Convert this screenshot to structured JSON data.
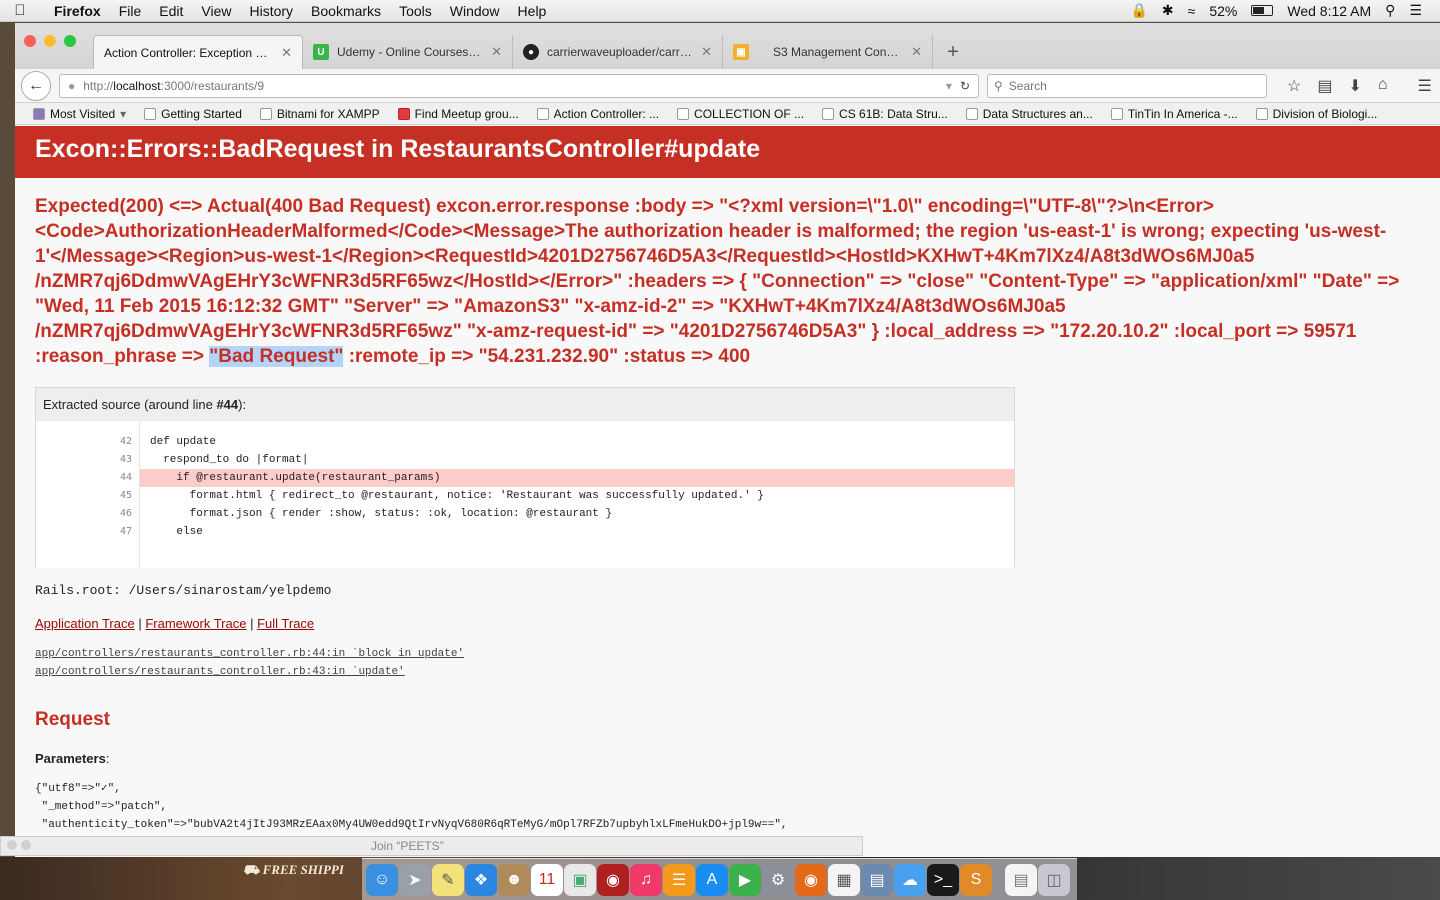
{
  "menubar": {
    "apple": "",
    "app_name": "Firefox",
    "menus": [
      "File",
      "Edit",
      "View",
      "History",
      "Bookmarks",
      "Tools",
      "Window",
      "Help"
    ],
    "battery": "52%",
    "clock": "Wed 8:12 AM"
  },
  "tabs": [
    {
      "title": "Action Controller: Exception cau...",
      "favicon": "document-icon",
      "active": true
    },
    {
      "title": "Udemy - Online Courses fro...",
      "favicon": "udemy-icon",
      "active": false
    },
    {
      "title": "carrierwaveuploader/carrier...",
      "favicon": "github-icon",
      "active": false
    },
    {
      "title": "S3 Management Console",
      "favicon": "aws-cube-icon",
      "active": false
    }
  ],
  "nav": {
    "url_prefix": "http://",
    "url_host": "localhost",
    "url_rest": ":3000/restaurants/9",
    "search_placeholder": "Search"
  },
  "bookmarks": [
    "Most Visited",
    "Getting Started",
    "Bitnami for XAMPP",
    "Find Meetup grou...",
    "Action Controller: ...",
    "COLLECTION OF ...",
    "CS 61B: Data Stru...",
    "Data Structures an...",
    "TinTin In America -...",
    "Division of Biologi..."
  ],
  "error": {
    "title": "Excon::Errors::BadRequest in RestaurantsController#update",
    "message_before": "Expected(200) <=> Actual(400 Bad Request) excon.error.response :body => \"<?xml version=\\\"1.0\\\" encoding=\\\"UTF-8\\\"?>\\n<Error><Code>AuthorizationHeaderMalformed</Code><Message>The authorization header is malformed; the region 'us-east-1' is wrong; expecting 'us-west-1'</Message><Region>us-west-1</Region><RequestId>4201D2756746D5A3</RequestId><HostId>KXHwT+4Km7lXz4/A8t3dWOs6MJ0a5 /nZMR7qj6DdmwVAgEHrY3cWFNR3d5RF65wz</HostId></Error>\" :headers => { \"Connection\" => \"close\" \"Content-Type\" => \"application/xml\" \"Date\" => \"Wed, 11 Feb 2015 16:12:32 GMT\" \"Server\" => \"AmazonS3\" \"x-amz-id-2\" => \"KXHwT+4Km7lXz4/A8t3dWOs6MJ0a5 /nZMR7qj6DdmwVAgEHrY3cWFNR3d5RF65wz\" \"x-amz-request-id\" => \"4201D2756746D5A3\" } :local_address => \"172.20.10.2\" :local_port => 59571 :reason_phrase => ",
    "message_highlight": "\"Bad Request\"",
    "message_after": " :remote_ip => \"54.231.232.90\" :status => 400"
  },
  "source": {
    "header_prefix": "Extracted source (around line ",
    "header_line": "#44",
    "header_suffix": "):",
    "line_numbers": [
      "42",
      "43",
      "44",
      "45",
      "46",
      "47"
    ],
    "lines": [
      "def update",
      "  respond_to do |format|",
      "    if @restaurant.update(restaurant_params)",
      "      format.html { redirect_to @restaurant, notice: 'Restaurant was successfully updated.' }",
      "      format.json { render :show, status: :ok, location: @restaurant }",
      "    else"
    ]
  },
  "rails_root": "Rails.root: /Users/sinarostam/yelpdemo",
  "trace_links": {
    "application": "Application Trace",
    "separator": " | ",
    "framework": "Framework Trace",
    "full": "Full Trace"
  },
  "trace_lines": [
    "app/controllers/restaurants_controller.rb:44:in `block in update'",
    "app/controllers/restaurants_controller.rb:43:in `update'"
  ],
  "request": {
    "heading": "Request",
    "params_label": "Parameters",
    "params_colon": ":",
    "params_lines": [
      "{\"utf8\"=>\"✓\",",
      " \"_method\"=>\"patch\",",
      " \"authenticity_token\"=>\"bubVA2t4jItJ93MRzEAax0My4UW0edd9QtIrvNyqV680R6qRTeMyG/mOpl7RFZb7upbyhlxLFmeHukDO+jpl9w==\","
    ]
  },
  "joinbar": "Join “PEETS”",
  "desktop_banner": "FREE SHIPPI",
  "dock_icons": [
    "finder-icon",
    "launchpad-icon",
    "notes-icon",
    "safari-icon",
    "contacts-icon",
    "calendar-icon",
    "preview-icon",
    "photo-booth-icon",
    "itunes-icon",
    "ibooks-icon",
    "app-store-icon",
    "facetime-icon",
    "system-preferences-icon",
    "firefox-icon",
    "grid-app-icon",
    "preview-alt-icon",
    "messages-icon",
    "terminal-icon",
    "sublime-icon",
    "documents-icon",
    "trash-icon"
  ]
}
